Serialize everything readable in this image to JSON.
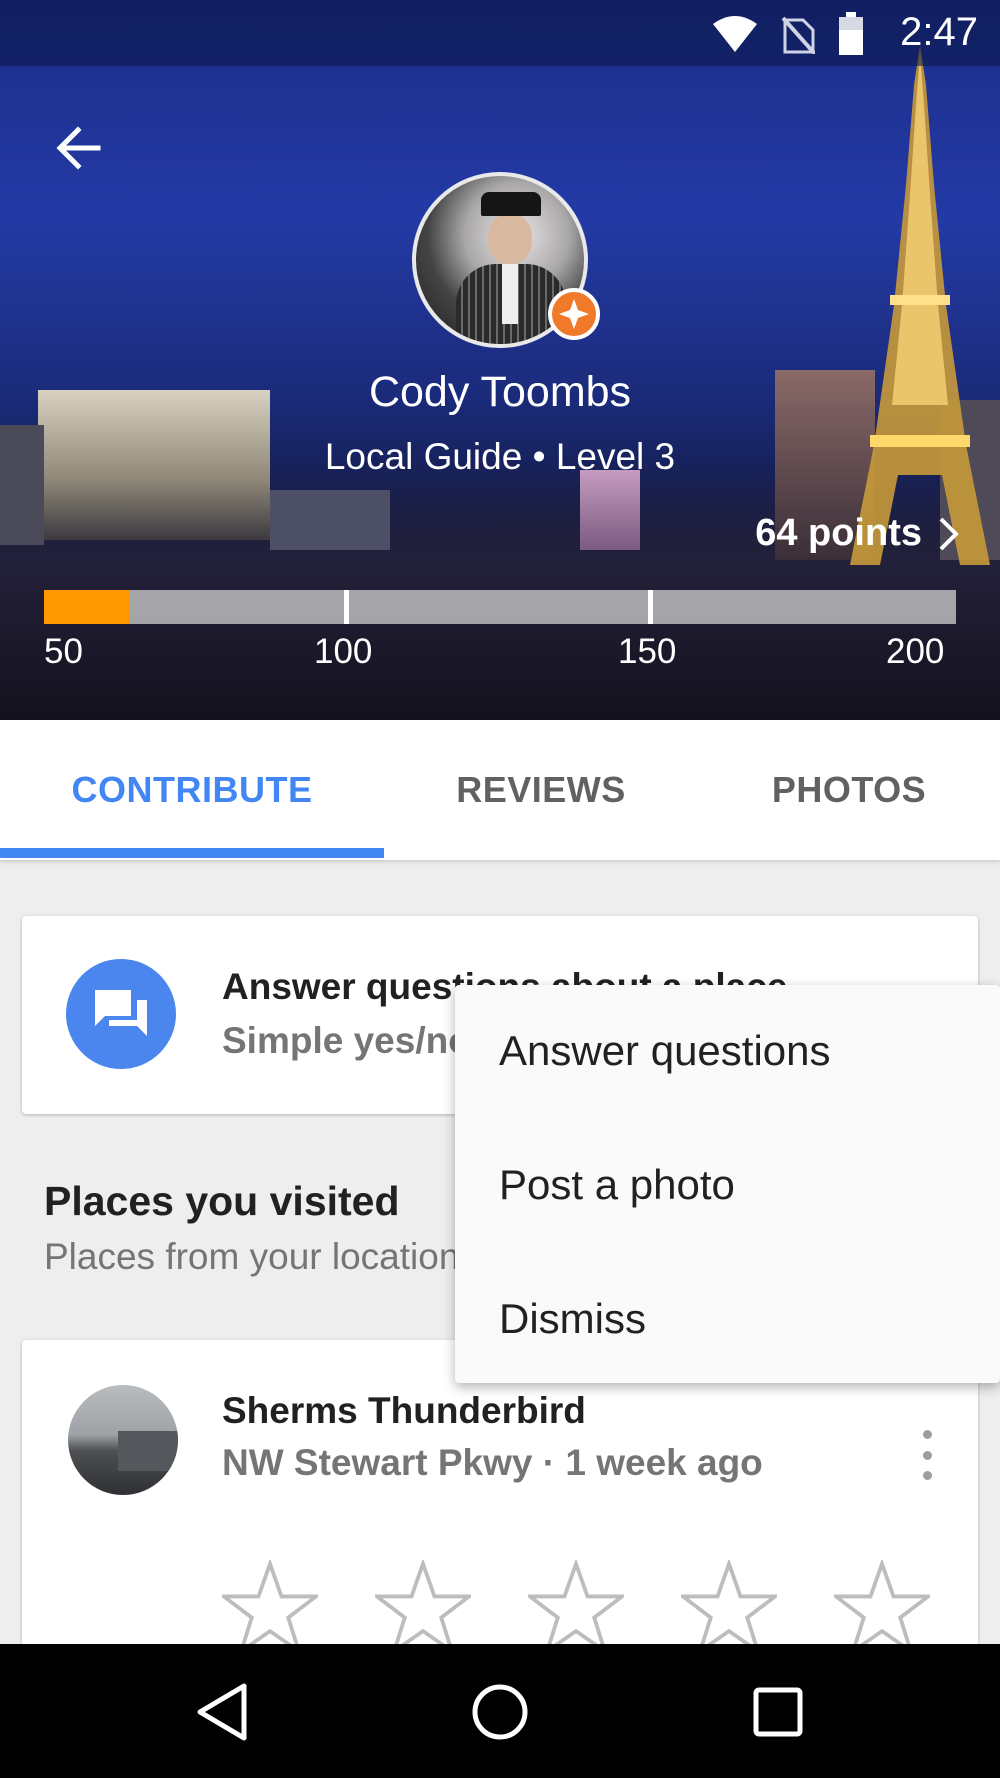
{
  "status_bar": {
    "time": "2:47",
    "icons": [
      "wifi-icon",
      "no-sim-icon",
      "battery-icon"
    ]
  },
  "header": {
    "back_icon": "arrow-left-icon",
    "name": "Cody Toombs",
    "level": "Local Guide • Level 3",
    "points": "64 points",
    "progress": {
      "value": 64,
      "min": 50,
      "max": 200
    },
    "ticks": [
      "50",
      "100",
      "150",
      "200"
    ]
  },
  "tabs": [
    {
      "label": "CONTRIBUTE",
      "active": true
    },
    {
      "label": "REVIEWS",
      "active": false
    },
    {
      "label": "PHOTOS",
      "active": false
    }
  ],
  "qa_card": {
    "title": "Answer questions about a place",
    "subtitle": "Simple yes/no"
  },
  "places_section": {
    "title": "Places you visited",
    "subtitle": "Places from your location"
  },
  "place_card": {
    "name": "Sherms Thunderbird",
    "meta": "NW Stewart Pkwy · 1 week ago",
    "stars": 5,
    "rating": 0
  },
  "menu": {
    "items": [
      "Answer questions",
      "Post a photo",
      "Dismiss"
    ]
  },
  "navbar": {
    "icons": [
      "back-triangle-icon",
      "home-circle-icon",
      "recents-square-icon"
    ]
  },
  "colors": {
    "accent": "#4286f4",
    "progress": "#ff9800",
    "badge": "#f07a2a"
  }
}
